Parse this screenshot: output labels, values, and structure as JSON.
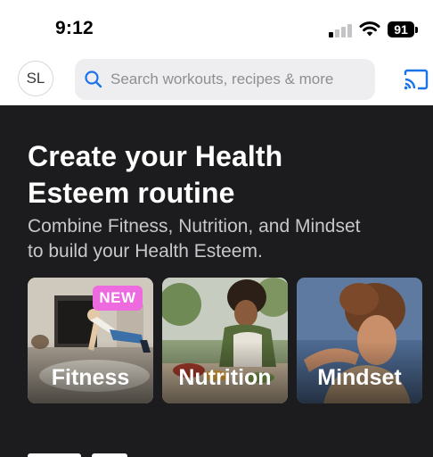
{
  "status_bar": {
    "time": "9:12",
    "battery": "91"
  },
  "header": {
    "avatar_initials": "SL",
    "search_placeholder": "Search workouts, recipes & more"
  },
  "hero": {
    "title_line1": "Create your Health",
    "title_line2": "Esteem routine",
    "subtitle_line1": "Combine Fitness, Nutrition, and Mindset",
    "subtitle_line2": "to build your Health Esteem."
  },
  "cards": [
    {
      "label": "Fitness",
      "badge": "NEW"
    },
    {
      "label": "Nutrition"
    },
    {
      "label": "Mindset"
    }
  ],
  "colors": {
    "accent": "#1a73e8",
    "badge": "#ee6adf",
    "background": "#1c1c1e"
  }
}
